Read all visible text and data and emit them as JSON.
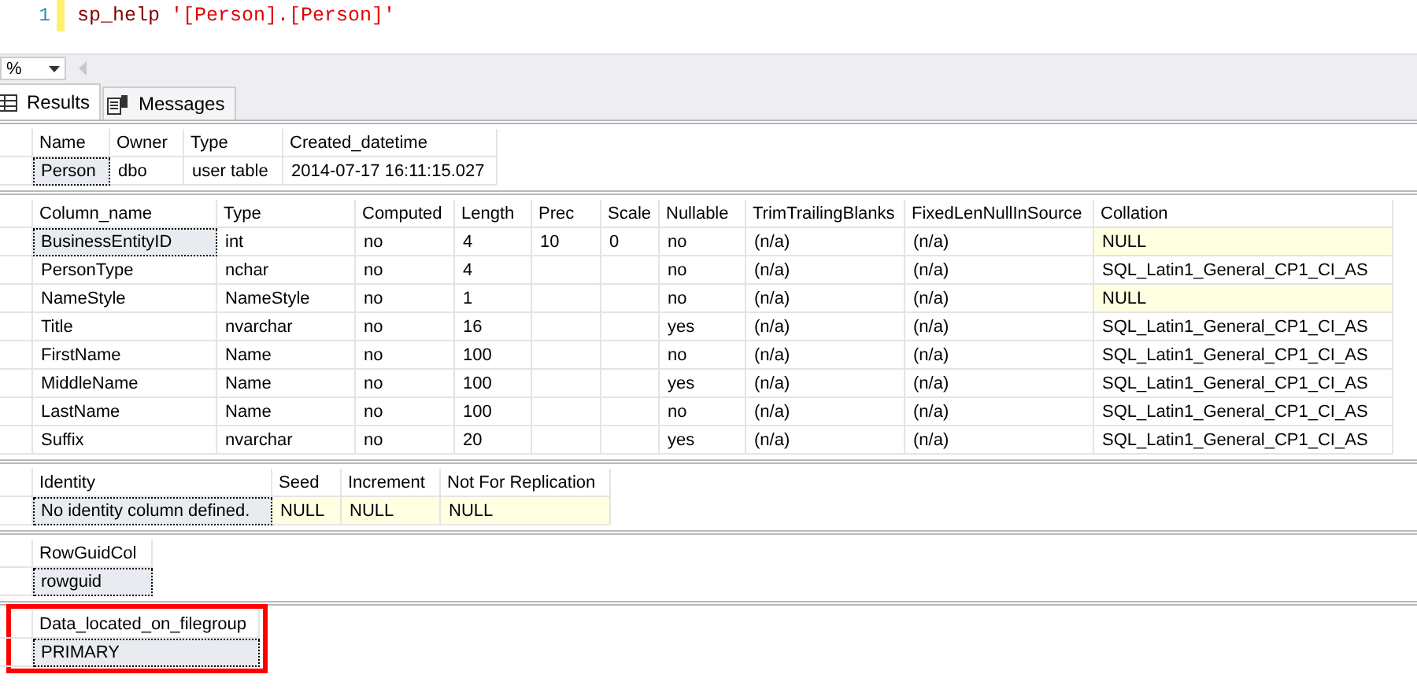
{
  "editor": {
    "line_number": "1",
    "tokens": [
      {
        "text": "sp_help",
        "kind": "procedure"
      },
      {
        "text": "'[Person].[Person]'",
        "kind": "string"
      }
    ]
  },
  "toolbar": {
    "zoom": "%"
  },
  "tabs": [
    {
      "label": "Results",
      "selected": true,
      "kind": "grid"
    },
    {
      "label": "Messages",
      "selected": false,
      "kind": "messages"
    }
  ],
  "grids": [
    {
      "highlighted": false,
      "columns": [
        "Name",
        "Owner",
        "Type",
        "Created_datetime"
      ],
      "rows": [
        [
          {
            "text": "Person",
            "selected": true
          },
          {
            "text": "dbo",
            "selected": false,
            "null_value": false
          },
          {
            "text": "user table",
            "selected": false,
            "null_value": false
          },
          {
            "text": "2014-07-17 16:11:15.027",
            "selected": false,
            "null_value": false
          }
        ]
      ]
    },
    {
      "highlighted": false,
      "columns": [
        "Column_name",
        "Type",
        "Computed",
        "Length",
        "Prec",
        "Scale",
        "Nullable",
        "TrimTrailingBlanks",
        "FixedLenNullInSource",
        "Collation"
      ],
      "rows": [
        [
          {
            "text": "BusinessEntityID",
            "selected": true
          },
          {
            "text": "int",
            "selected": false,
            "null_value": false
          },
          {
            "text": "no",
            "selected": false,
            "null_value": false
          },
          {
            "text": "4",
            "selected": false,
            "null_value": false
          },
          {
            "text": "10",
            "selected": false,
            "null_value": false
          },
          {
            "text": "0",
            "selected": false,
            "null_value": false
          },
          {
            "text": "no",
            "selected": false,
            "null_value": false
          },
          {
            "text": "(n/a)",
            "selected": false,
            "null_value": false
          },
          {
            "text": "(n/a)",
            "selected": false,
            "null_value": false
          },
          {
            "text": "NULL",
            "selected": false,
            "null_value": true
          }
        ],
        [
          {
            "text": "PersonType",
            "selected": false,
            "null_value": false
          },
          {
            "text": "nchar",
            "selected": false,
            "null_value": false
          },
          {
            "text": "no",
            "selected": false,
            "null_value": false
          },
          {
            "text": "4",
            "selected": false,
            "null_value": false
          },
          {
            "selected": false,
            "null_value": false
          },
          {
            "selected": false,
            "null_value": false
          },
          {
            "text": "no",
            "selected": false,
            "null_value": false
          },
          {
            "text": "(n/a)",
            "selected": false,
            "null_value": false
          },
          {
            "text": "(n/a)",
            "selected": false,
            "null_value": false
          },
          {
            "text": "SQL_Latin1_General_CP1_CI_AS",
            "selected": false,
            "null_value": false
          }
        ],
        [
          {
            "text": "NameStyle",
            "selected": false,
            "null_value": false
          },
          {
            "text": "NameStyle",
            "selected": false,
            "null_value": false
          },
          {
            "text": "no",
            "selected": false,
            "null_value": false
          },
          {
            "text": "1",
            "selected": false,
            "null_value": false
          },
          {
            "selected": false,
            "null_value": false
          },
          {
            "selected": false,
            "null_value": false
          },
          {
            "text": "no",
            "selected": false,
            "null_value": false
          },
          {
            "text": "(n/a)",
            "selected": false,
            "null_value": false
          },
          {
            "text": "(n/a)",
            "selected": false,
            "null_value": false
          },
          {
            "text": "NULL",
            "selected": false,
            "null_value": true
          }
        ],
        [
          {
            "text": "Title",
            "selected": false,
            "null_value": false
          },
          {
            "text": "nvarchar",
            "selected": false,
            "null_value": false
          },
          {
            "text": "no",
            "selected": false,
            "null_value": false
          },
          {
            "text": "16",
            "selected": false,
            "null_value": false
          },
          {
            "selected": false,
            "null_value": false
          },
          {
            "selected": false,
            "null_value": false
          },
          {
            "text": "yes",
            "selected": false,
            "null_value": false
          },
          {
            "text": "(n/a)",
            "selected": false,
            "null_value": false
          },
          {
            "text": "(n/a)",
            "selected": false,
            "null_value": false
          },
          {
            "text": "SQL_Latin1_General_CP1_CI_AS",
            "selected": false,
            "null_value": false
          }
        ],
        [
          {
            "text": "FirstName",
            "selected": false,
            "null_value": false
          },
          {
            "text": "Name",
            "selected": false,
            "null_value": false
          },
          {
            "text": "no",
            "selected": false,
            "null_value": false
          },
          {
            "text": "100",
            "selected": false,
            "null_value": false
          },
          {
            "selected": false,
            "null_value": false
          },
          {
            "selected": false,
            "null_value": false
          },
          {
            "text": "no",
            "selected": false,
            "null_value": false
          },
          {
            "text": "(n/a)",
            "selected": false,
            "null_value": false
          },
          {
            "text": "(n/a)",
            "selected": false,
            "null_value": false
          },
          {
            "text": "SQL_Latin1_General_CP1_CI_AS",
            "selected": false,
            "null_value": false
          }
        ],
        [
          {
            "text": "MiddleName",
            "selected": false,
            "null_value": false
          },
          {
            "text": "Name",
            "selected": false,
            "null_value": false
          },
          {
            "text": "no",
            "selected": false,
            "null_value": false
          },
          {
            "text": "100",
            "selected": false,
            "null_value": false
          },
          {
            "selected": false,
            "null_value": false
          },
          {
            "selected": false,
            "null_value": false
          },
          {
            "text": "yes",
            "selected": false,
            "null_value": false
          },
          {
            "text": "(n/a)",
            "selected": false,
            "null_value": false
          },
          {
            "text": "(n/a)",
            "selected": false,
            "null_value": false
          },
          {
            "text": "SQL_Latin1_General_CP1_CI_AS",
            "selected": false,
            "null_value": false
          }
        ],
        [
          {
            "text": "LastName",
            "selected": false,
            "null_value": false
          },
          {
            "text": "Name",
            "selected": false,
            "null_value": false
          },
          {
            "text": "no",
            "selected": false,
            "null_value": false
          },
          {
            "text": "100",
            "selected": false,
            "null_value": false
          },
          {
            "selected": false,
            "null_value": false
          },
          {
            "selected": false,
            "null_value": false
          },
          {
            "text": "no",
            "selected": false,
            "null_value": false
          },
          {
            "text": "(n/a)",
            "selected": false,
            "null_value": false
          },
          {
            "text": "(n/a)",
            "selected": false,
            "null_value": false
          },
          {
            "text": "SQL_Latin1_General_CP1_CI_AS",
            "selected": false,
            "null_value": false
          }
        ],
        [
          {
            "text": "Suffix",
            "selected": false,
            "null_value": false
          },
          {
            "text": "nvarchar",
            "selected": false,
            "null_value": false
          },
          {
            "text": "no",
            "selected": false,
            "null_value": false
          },
          {
            "text": "20",
            "selected": false,
            "null_value": false
          },
          {
            "selected": false,
            "null_value": false
          },
          {
            "selected": false,
            "null_value": false
          },
          {
            "text": "yes",
            "selected": false,
            "null_value": false
          },
          {
            "text": "(n/a)",
            "selected": false,
            "null_value": false
          },
          {
            "text": "(n/a)",
            "selected": false,
            "null_value": false
          },
          {
            "text": "SQL_Latin1_General_CP1_CI_AS",
            "selected": false,
            "null_value": false
          }
        ]
      ]
    },
    {
      "highlighted": false,
      "columns": [
        "Identity",
        "Seed",
        "Increment",
        "Not For Replication"
      ],
      "rows": [
        [
          {
            "text": "No identity column defined.",
            "selected": true
          },
          {
            "text": "NULL",
            "selected": false,
            "null_value": true
          },
          {
            "text": "NULL",
            "selected": false,
            "null_value": true
          },
          {
            "text": "NULL",
            "selected": false,
            "null_value": true
          }
        ]
      ]
    },
    {
      "highlighted": false,
      "columns": [
        "RowGuidCol"
      ],
      "rows": [
        [
          {
            "text": "rowguid",
            "selected": true
          }
        ]
      ]
    },
    {
      "highlighted": true,
      "columns": [
        "Data_located_on_filegroup"
      ],
      "rows": [
        [
          {
            "text": "PRIMARY",
            "selected": true
          }
        ]
      ]
    }
  ]
}
